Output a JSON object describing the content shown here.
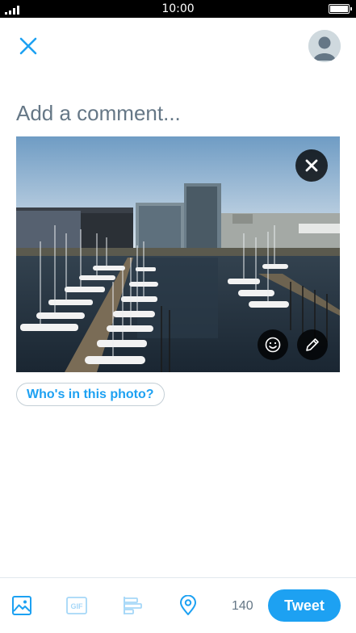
{
  "status_bar": {
    "time": "10:00"
  },
  "header": {
    "close_icon": "close-icon",
    "avatar_icon": "default-avatar"
  },
  "composer": {
    "placeholder": "Add a comment..."
  },
  "media": {
    "remove_icon": "close-icon",
    "sticker_icon": "smiley-icon",
    "edit_icon": "pencil-icon"
  },
  "tag_button": {
    "label": "Who's in this photo?"
  },
  "toolbar": {
    "icons": [
      "image-icon",
      "gif-icon",
      "poll-icon",
      "location-icon"
    ],
    "char_count": "140",
    "tweet_label": "Tweet"
  },
  "colors": {
    "accent": "#1da1f2",
    "muted": "#657786",
    "disabled": "#a5d7f8"
  }
}
